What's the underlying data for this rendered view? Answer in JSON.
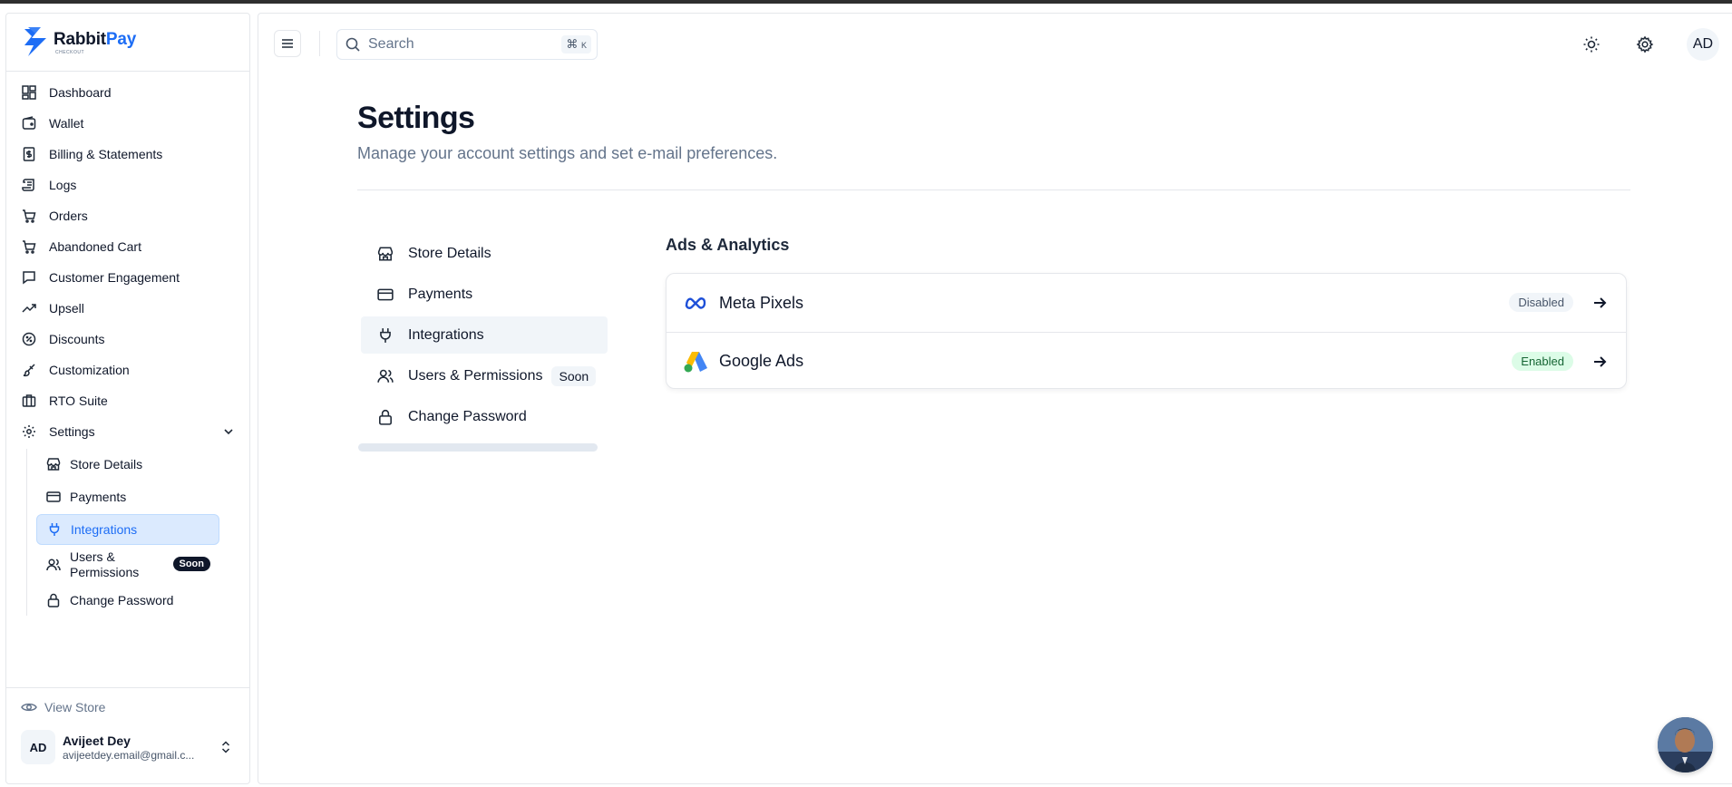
{
  "brand": {
    "name_part1": "Rabbit",
    "name_part2": "Pay",
    "tagline": "CHECKOUT",
    "accent": "#1d6df5"
  },
  "sidebar": {
    "items": [
      {
        "label": "Dashboard",
        "icon": "dashboard-icon"
      },
      {
        "label": "Wallet",
        "icon": "wallet-icon"
      },
      {
        "label": "Billing & Statements",
        "icon": "receipt-icon"
      },
      {
        "label": "Logs",
        "icon": "scroll-icon"
      },
      {
        "label": "Orders",
        "icon": "cart-icon"
      },
      {
        "label": "Abandoned Cart",
        "icon": "cart-icon"
      },
      {
        "label": "Customer Engagement",
        "icon": "message-icon"
      },
      {
        "label": "Upsell",
        "icon": "trend-up-icon"
      },
      {
        "label": "Discounts",
        "icon": "percent-badge-icon"
      },
      {
        "label": "Customization",
        "icon": "brush-icon"
      },
      {
        "label": "RTO Suite",
        "icon": "briefcase-icon"
      },
      {
        "label": "Settings",
        "icon": "gear-icon"
      }
    ],
    "settings_sub": [
      {
        "label": "Store Details",
        "icon": "store-icon"
      },
      {
        "label": "Payments",
        "icon": "credit-card-icon"
      },
      {
        "label": "Integrations",
        "icon": "plug-icon",
        "active": true
      },
      {
        "label_line1": "Users &",
        "label_line2": "Permissions",
        "badge": "Soon",
        "icon": "users-icon"
      },
      {
        "label": "Change Password",
        "icon": "lock-icon"
      }
    ],
    "view_store": "View Store",
    "user": {
      "initials": "AD",
      "name": "Avijeet Dey",
      "email": "avijeetdey.email@gmail.c..."
    }
  },
  "topbar": {
    "search_placeholder": "Search",
    "shortcut_symbol": "⌘",
    "shortcut_key": "K",
    "avatar_initials": "AD"
  },
  "page": {
    "title": "Settings",
    "subtitle": "Manage your account settings and set e-mail preferences."
  },
  "settings_nav": [
    {
      "label": "Store Details",
      "icon": "store-icon"
    },
    {
      "label": "Payments",
      "icon": "credit-card-icon"
    },
    {
      "label": "Integrations",
      "icon": "plug-icon",
      "active": true
    },
    {
      "label": "Users & Permissions",
      "badge": "Soon",
      "icon": "users-icon"
    },
    {
      "label": "Change Password",
      "icon": "lock-icon"
    }
  ],
  "ads": {
    "title": "Ads & Analytics",
    "rows": [
      {
        "name": "Meta Pixels",
        "status": "Disabled",
        "icon": "meta-logo-icon"
      },
      {
        "name": "Google Ads",
        "status": "Enabled",
        "icon": "google-ads-logo-icon"
      }
    ]
  }
}
